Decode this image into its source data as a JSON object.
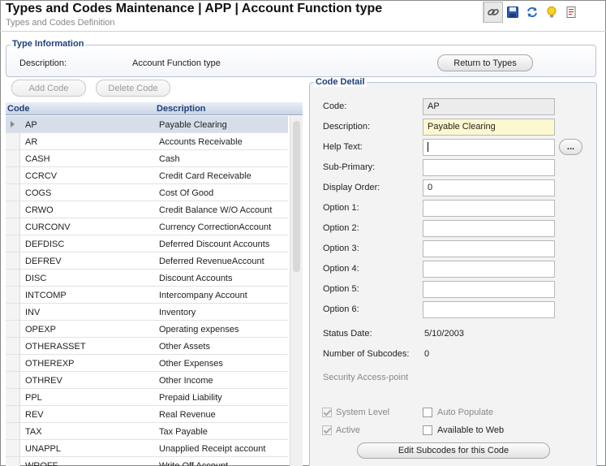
{
  "header": {
    "title": "Types and Codes Maintenance  |  APP | Account Function type",
    "subtitle": "Types and Codes Definition",
    "toolbar_icons": [
      "link-icon",
      "save-icon",
      "refresh-icon",
      "lightbulb-icon",
      "report-icon"
    ]
  },
  "type_info": {
    "legend": "Type Information",
    "description_label": "Description:",
    "description_value": "Account Function type",
    "return_button": "Return to Types"
  },
  "grid_actions": {
    "add_code": "Add Code",
    "delete_code": "Delete Code"
  },
  "grid": {
    "columns": [
      "Code",
      "Description"
    ],
    "rows": [
      {
        "code": "AP",
        "description": "Payable Clearing"
      },
      {
        "code": "AR",
        "description": "Accounts Receivable"
      },
      {
        "code": "CASH",
        "description": "Cash"
      },
      {
        "code": "CCRCV",
        "description": "Credit Card Receivable"
      },
      {
        "code": "COGS",
        "description": "Cost Of Good"
      },
      {
        "code": "CRWO",
        "description": "Credit Balance W/O Account"
      },
      {
        "code": "CURCONV",
        "description": "Currency CorrectionAccount"
      },
      {
        "code": "DEFDISC",
        "description": "Deferred Discount Accounts"
      },
      {
        "code": "DEFREV",
        "description": "Deferred RevenueAccount"
      },
      {
        "code": "DISC",
        "description": "Discount Accounts"
      },
      {
        "code": "INTCOMP",
        "description": "Intercompany Account"
      },
      {
        "code": "INV",
        "description": "Inventory"
      },
      {
        "code": "OPEXP",
        "description": "Operating expenses"
      },
      {
        "code": "OTHERASSET",
        "description": "Other Assets"
      },
      {
        "code": "OTHEREXP",
        "description": "Other Expenses"
      },
      {
        "code": "OTHREV",
        "description": "Other Income"
      },
      {
        "code": "PPL",
        "description": "Prepaid Liability"
      },
      {
        "code": "REV",
        "description": "Real Revenue"
      },
      {
        "code": "TAX",
        "description": "Tax Payable"
      },
      {
        "code": "UNAPPL",
        "description": "Unapplied Receipt account"
      },
      {
        "code": "WROFF",
        "description": "Write Off Account"
      }
    ]
  },
  "detail": {
    "legend": "Code Detail",
    "code_label": "Code:",
    "code_value": "AP",
    "description_label": "Description:",
    "description_value": "Payable Clearing",
    "help_text_label": "Help Text:",
    "help_text_value": "",
    "help_button": "...",
    "sub_primary_label": "Sub-Primary:",
    "sub_primary_value": "",
    "display_order_label": "Display Order:",
    "display_order_value": "0",
    "option1_label": "Option 1:",
    "option2_label": "Option 2:",
    "option3_label": "Option 3:",
    "option4_label": "Option 4:",
    "option5_label": "Option 5:",
    "option6_label": "Option 6:",
    "status_date_label": "Status Date:",
    "status_date_value": "5/10/2003",
    "subcodes_label": "Number of Subcodes:",
    "subcodes_value": "0",
    "security_label": "Security Access-point",
    "system_level_label": "System Level",
    "auto_populate_label": "Auto Populate",
    "active_label": "Active",
    "available_web_label": "Available to Web",
    "edit_subcodes_button": "Edit Subcodes for this Code"
  }
}
